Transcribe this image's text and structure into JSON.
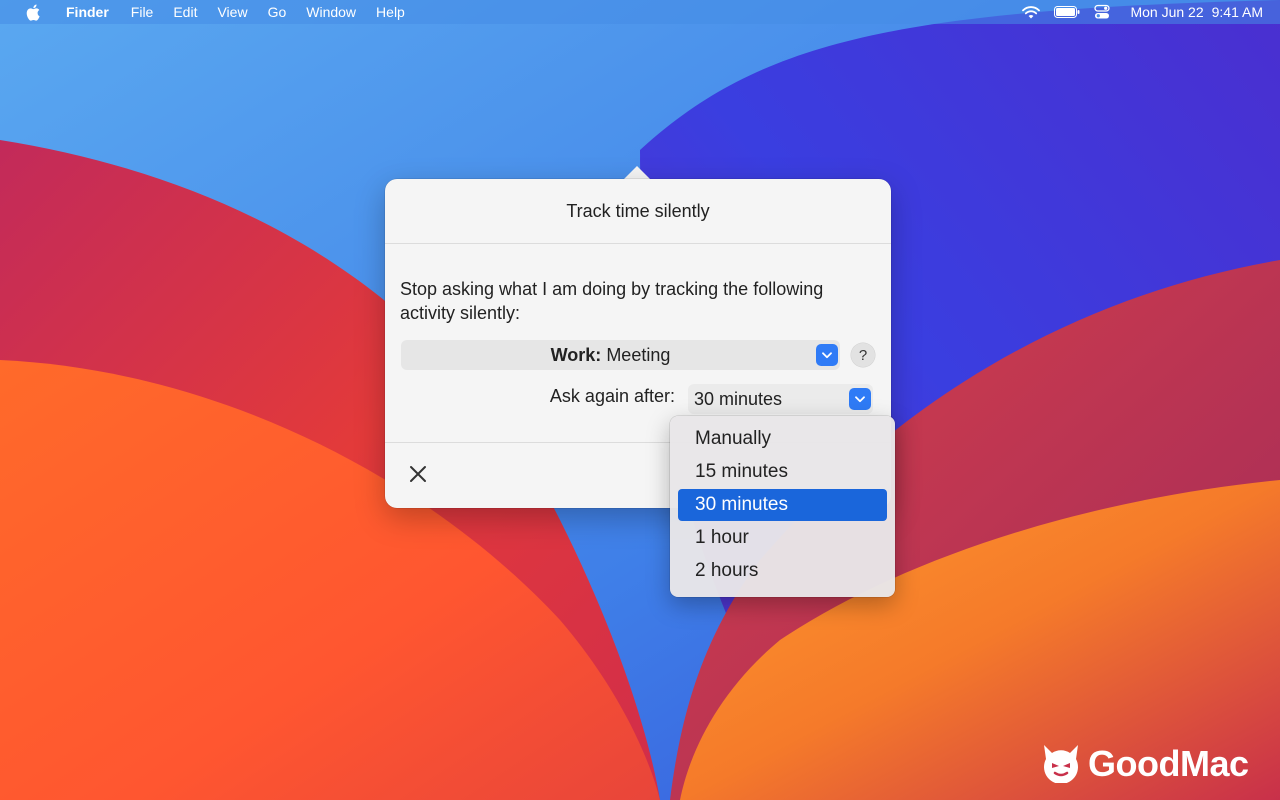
{
  "menubar": {
    "app_name": "Finder",
    "menus": [
      "File",
      "Edit",
      "View",
      "Go",
      "Window",
      "Help"
    ],
    "date": "Mon Jun 22",
    "time": "9:41 AM",
    "status_icons": [
      "wifi-icon",
      "battery-icon",
      "control-center-icon"
    ]
  },
  "popover": {
    "title": "Track time silently",
    "description": "Stop asking what I am doing by tracking the following activity silently:",
    "activity": {
      "category": "Work:",
      "name": "Meeting"
    },
    "help_label": "?",
    "ask_again_label": "Ask again after:",
    "ask_again_value": "30 minutes"
  },
  "dropdown": {
    "options": [
      "Manually",
      "15 minutes",
      "30 minutes",
      "1 hour",
      "2 hours"
    ],
    "selected": "30 minutes"
  },
  "watermark": {
    "brand": "GoodMac"
  },
  "colors": {
    "accent": "#2f7bf6",
    "selection": "#1a66db",
    "popover_bg": "#f5f5f5"
  }
}
